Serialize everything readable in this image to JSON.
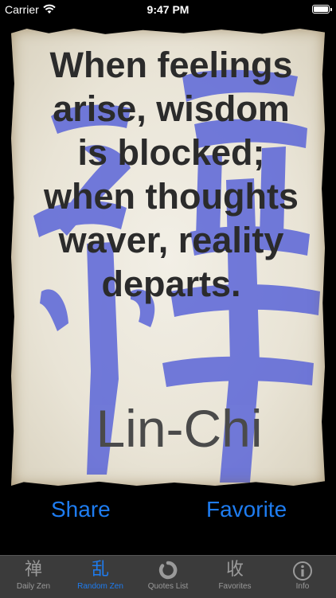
{
  "status_bar": {
    "carrier": "Carrier",
    "time": "9:47 PM"
  },
  "quote": {
    "lines": [
      "When feelings",
      "arise, wisdom",
      "is blocked;",
      "when thoughts",
      "waver, reality",
      "departs."
    ],
    "author": "Lin-Chi",
    "background_glyph": "禅"
  },
  "actions": {
    "share": "Share",
    "favorite": "Favorite"
  },
  "tabs": [
    {
      "glyph": "禅",
      "label": "Daily Zen",
      "active": false
    },
    {
      "glyph": "乱",
      "label": "Random Zen",
      "active": true
    },
    {
      "icon": "enso-icon",
      "label": "Quotes List",
      "active": false
    },
    {
      "glyph": "收",
      "label": "Favorites",
      "active": false
    },
    {
      "icon": "info-icon",
      "label": "Info",
      "active": false
    }
  ],
  "colors": {
    "accent": "#1e7cf0",
    "tabbar": "#3b3b3b",
    "ink": "#2b2b2b",
    "brush": "#5560d8"
  }
}
